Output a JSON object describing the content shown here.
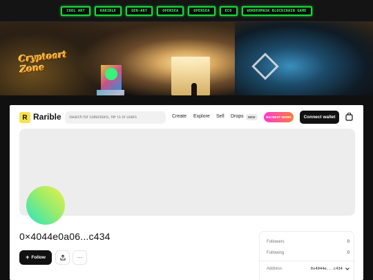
{
  "top_nav": {
    "buttons": [
      "COOL ART",
      "RARIBLE",
      "GEN-ART",
      "OPENSEA",
      "OPENSEA",
      "ECO",
      "WONDERMASK BLOCKCHAIN GAME"
    ]
  },
  "banner": {
    "logo_text": "Cryptoart Zone"
  },
  "header": {
    "brand": "Rarible",
    "search_placeholder": "Search for collections, NFTs or users",
    "nav": [
      "Create",
      "Explore",
      "Sell",
      "Drops"
    ],
    "new_badge": "NEW",
    "promo_label": "RAI BEST WORK",
    "connect_label": "Connect wallet"
  },
  "profile": {
    "address_title": "0×4044e0a06...c434",
    "follow_label": "Follow",
    "share_icon": "share-icon",
    "more_label": "···"
  },
  "stats": {
    "followers_label": "Followers",
    "followers_value": "0",
    "following_label": "Following",
    "following_value": "0",
    "address_label": "Address",
    "address_value": "0x4044e...c434"
  },
  "colors": {
    "neon_green": "#19d63a",
    "logo_yellow": "#f9e24a",
    "black_button": "#111111",
    "promo_gradient_start": "#ff3bd0"
  }
}
